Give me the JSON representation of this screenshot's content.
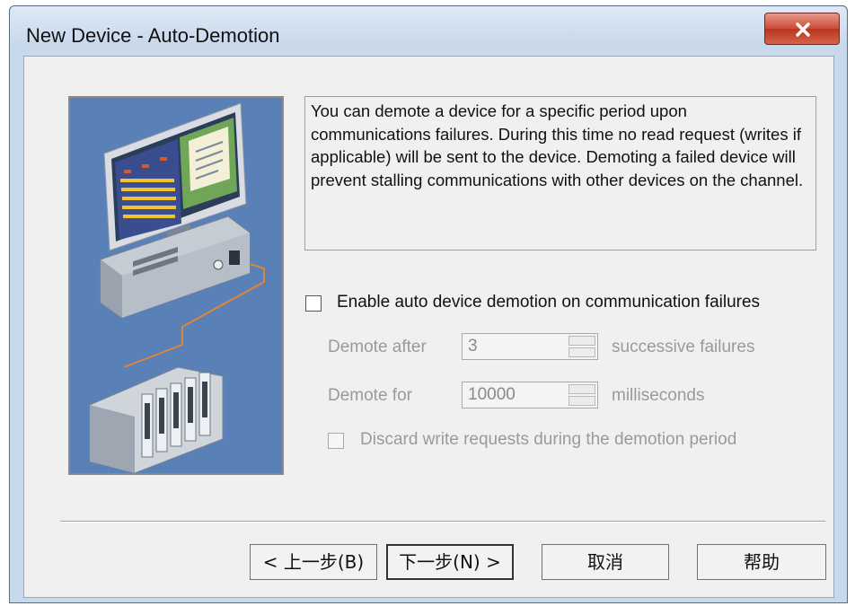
{
  "window": {
    "title": "New Device - Auto-Demotion"
  },
  "description": "You can demote a device for a specific period upon communications failures. During this time no read request (writes if applicable) will be sent to the device. Demoting a failed device will prevent stalling communications with other devices on the channel.",
  "options": {
    "enable_label": "Enable auto device demotion on communication failures",
    "enable_checked": false,
    "demote_after_label": "Demote after",
    "demote_after_value": "3",
    "demote_after_unit": "successive failures",
    "demote_for_label": "Demote for",
    "demote_for_value": "10000",
    "demote_for_unit": "milliseconds",
    "discard_label": "Discard write requests during the demotion period",
    "discard_checked": false
  },
  "buttons": {
    "back": "< 上一步(B)",
    "next": "下一步(N) >",
    "cancel": "取消",
    "help": "帮助"
  },
  "colors": {
    "illustration_bg": "#5a80b8",
    "close_button": "#cc4b37"
  },
  "icons": {
    "close": "close-x-icon"
  }
}
